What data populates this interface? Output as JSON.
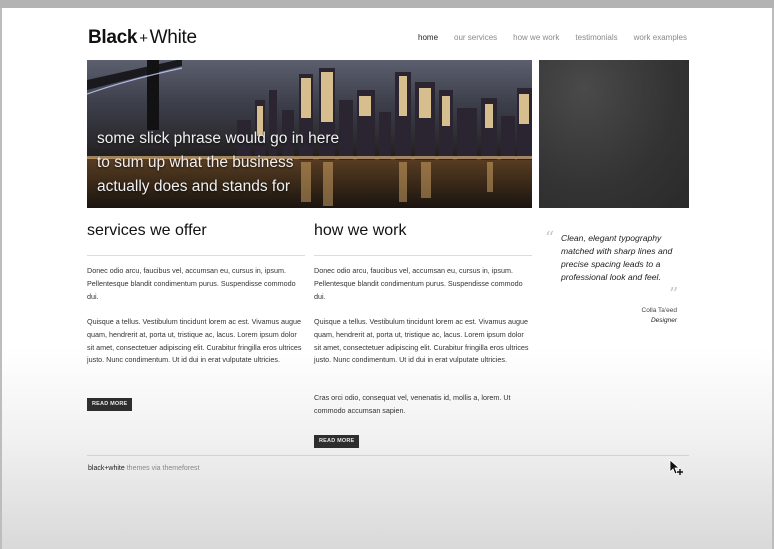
{
  "logo": {
    "bold": "Black",
    "plus": "+",
    "light": "White"
  },
  "nav": {
    "items": [
      "home",
      "our services",
      "how we work",
      "testimonials",
      "work examples"
    ]
  },
  "hero": {
    "lines": [
      "some slick phrase would go in here",
      "to sum up what the business",
      "actually does and stands for"
    ]
  },
  "services": {
    "title": "services we offer",
    "p1": "Donec odio arcu, faucibus vel, accumsan eu, cursus in, ipsum. Pellentesque blandit condimentum purus. Suspendisse commodo dui.",
    "p2": "Quisque a tellus. Vestibulum tincidunt lorem ac est. Vivamus augue quam, hendrerit at, porta ut, tristique ac, lacus. Lorem ipsum dolor sit amet, consectetuer adipiscing elit. Curabitur fringilla eros ultrices justo. Nunc condimentum. Ut id dui in erat vulputate ultricies.",
    "button": "READ MORE"
  },
  "how_we_work": {
    "title": "how we work",
    "p1": "Donec odio arcu, faucibus vel, accumsan eu, cursus in, ipsum. Pellentesque blandit condimentum purus. Suspendisse commodo dui.",
    "p2": "Quisque a tellus. Vestibulum tincidunt lorem ac est. Vivamus augue quam, hendrerit at, porta ut, tristique ac, lacus. Lorem ipsum dolor sit amet, consectetuer adipiscing elit. Curabitur fringilla eros ultrices justo. Nunc condimentum. Ut id dui in erat vulputate ultricies.",
    "p3": "Cras orci odio, consequat vel, venenatis id, mollis a, lorem. Ut commodo accumsan sapien.",
    "button": "READ MORE"
  },
  "testimonial": {
    "open_mark": "“",
    "close_mark": "”",
    "text": "Clean, elegant typography matched with sharp lines and precise spacing leads to a professional look and feel.",
    "name": "Colla Ta'eed",
    "role": "Designer"
  },
  "footer": {
    "brand": "black+white",
    "rest": " themes via themeforest"
  }
}
